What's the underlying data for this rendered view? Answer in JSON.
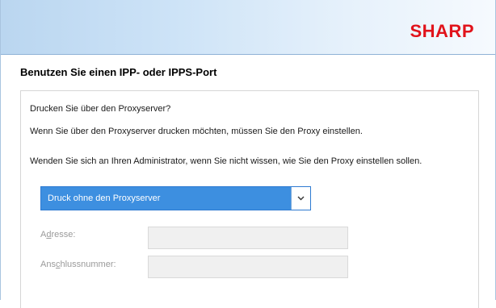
{
  "banner": {
    "logo_text": "SHARP",
    "logo_color": "#e1131b"
  },
  "page": {
    "title": "Benutzen Sie einen IPP- oder IPPS-Port"
  },
  "proxy_section": {
    "question": "Drucken Sie über den Proxyserver?",
    "info_line_1": "Wenn Sie über den Proxyserver drucken möchten, müssen Sie den Proxy einstellen.",
    "info_line_2": "Wenden Sie sich an Ihren Administrator, wenn Sie nicht wissen, wie Sie den Proxy einstellen sollen.",
    "proxy_select": {
      "selected": "Druck ohne den Proxyserver",
      "accent": "#3d8fe0"
    },
    "address": {
      "label_pre": "A",
      "label_key": "d",
      "label_post": "resse:",
      "value": ""
    },
    "port_number": {
      "label_pre": "Ans",
      "label_key": "c",
      "label_post": "hlussnummer:",
      "value": ""
    }
  }
}
